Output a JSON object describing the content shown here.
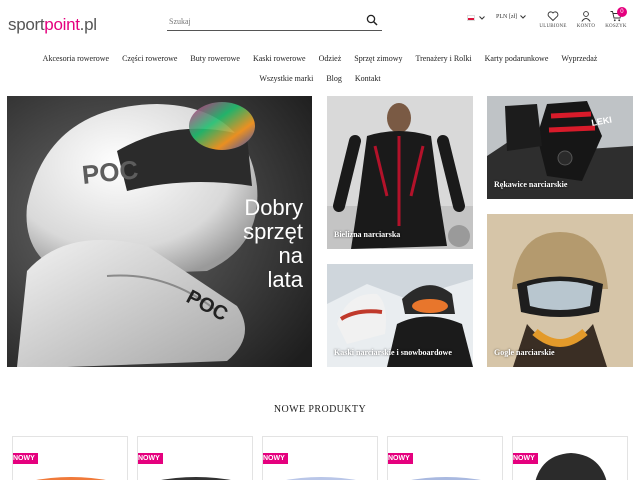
{
  "header": {
    "logo_part1": "sport",
    "logo_part2": "point",
    "logo_part3": ".pl",
    "search_placeholder": "Szukaj",
    "currency": "PLN [zł]",
    "wishlist_label": "ULUBIONE",
    "account_label": "KONTO",
    "cart_label": "KOSZYK",
    "cart_count": "0"
  },
  "nav": {
    "row1": [
      "Akcesoria rowerowe",
      "Części rowerowe",
      "Buty rowerowe",
      "Kaski rowerowe",
      "Odzież",
      "Sprzęt zimowy",
      "Trenażery i Rolki",
      "Karty podarunkowe",
      "Wyprzedaż"
    ],
    "row2": [
      "Wszystkie marki",
      "Blog",
      "Kontakt"
    ]
  },
  "hero": {
    "slogan": [
      "Dobry",
      "sprzęt",
      "na",
      "lata"
    ],
    "brand_print": "POC"
  },
  "tiles": {
    "underwear": "Bielizna narciarska",
    "gloves": "Rękawice narciarskie",
    "helmets": "Kaski narciarskie i snowboardowe",
    "goggles": "Gogle narciarskie",
    "glove_brand": "LEKI"
  },
  "products": {
    "section_title": "NOWE PRODUKTY",
    "badge": "NOWY",
    "cards": [
      1,
      2,
      3,
      4,
      5
    ]
  },
  "colors": {
    "brand": "#e5007e"
  }
}
